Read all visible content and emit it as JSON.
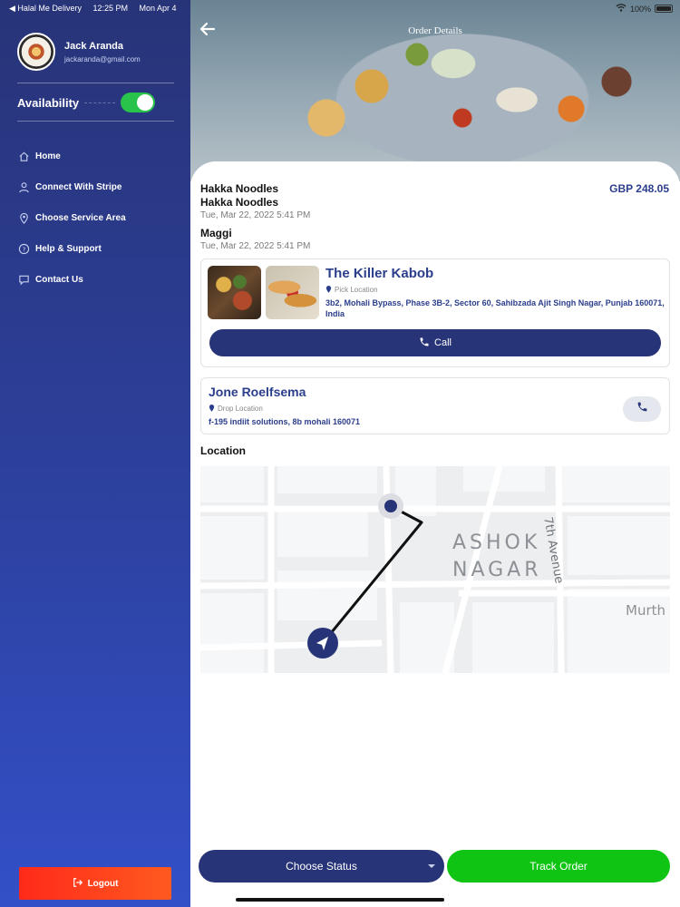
{
  "status_bar": {
    "back_app": "◀ Halal Me Delivery",
    "time": "12:25 PM",
    "date": "Mon Apr 4",
    "battery": "100%"
  },
  "sidebar": {
    "user_name": "Jack Aranda",
    "user_email": "jackaranda@gmail.com",
    "availability_label": "Availability",
    "availability_on": true,
    "items": [
      {
        "label": "Home",
        "icon": "home-icon"
      },
      {
        "label": "Connect With Stripe",
        "icon": "user-icon"
      },
      {
        "label": "Choose Service Area",
        "icon": "location-pin-icon"
      },
      {
        "label": "Help & Support",
        "icon": "help-icon"
      },
      {
        "label": "Contact Us",
        "icon": "chat-icon"
      }
    ],
    "logout_label": "Logout"
  },
  "order": {
    "title": "Order Details",
    "price": "GBP 248.05",
    "items": [
      {
        "name": "Hakka Noodles",
        "date": ""
      },
      {
        "name": "Hakka Noodles",
        "date": "Tue, Mar 22, 2022 5:41 PM"
      },
      {
        "name": "Maggi",
        "date": "Tue, Mar 22, 2022 5:41 PM"
      }
    ],
    "pickup": {
      "restaurant": "The Killer Kabob",
      "location_label": "Pick Location",
      "address": "3b2, Mohali Bypass, Phase 3B-2, Sector 60, Sahibzada Ajit Singh Nagar, Punjab 160071, India",
      "call_label": "Call"
    },
    "drop": {
      "name": "Jone Roelfsema",
      "location_label": "Drop Location",
      "address": "f-195 indiit solutions, 8b mohali 160071"
    },
    "location_heading": "Location",
    "map": {
      "area_line1": "ASHOK",
      "area_line2": "NAGAR",
      "street": "7th Avenue",
      "edge_label": "Murth"
    },
    "status_label": "Choose Status",
    "track_label": "Track Order"
  },
  "colors": {
    "primary": "#283478",
    "accent_green": "#10c414",
    "logout_red": "#ff3a1c",
    "toggle_green": "#29c24a"
  }
}
